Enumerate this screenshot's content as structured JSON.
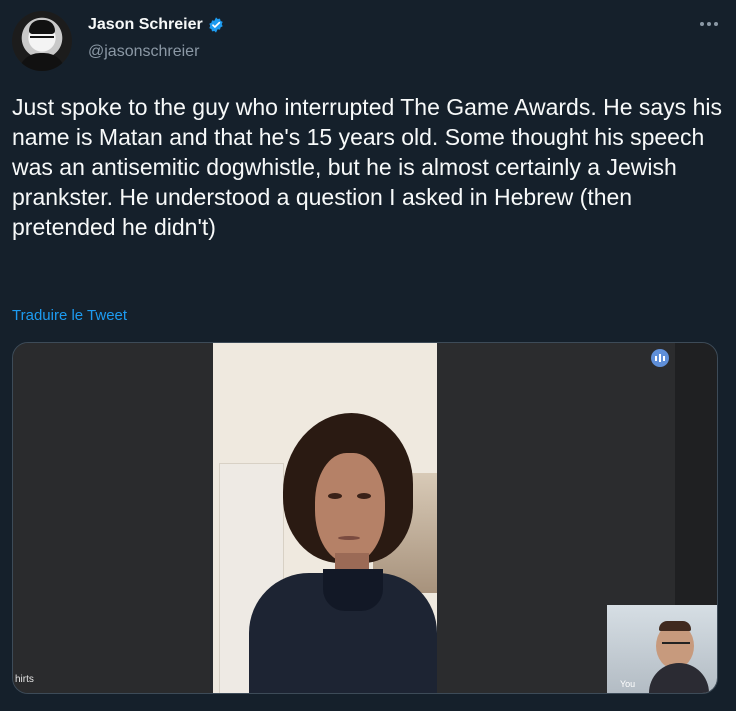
{
  "author": {
    "name": "Jason Schreier",
    "handle": "@jasonschreier",
    "verified_color": "#1d9bf0"
  },
  "tweet": {
    "text": "Just spoke to the guy who interrupted The Game Awards. He says his name is Matan and that he's 15 years old. Some thought his speech was an antisemitic dogwhistle, but he is almost certainly a Jewish prankster. He understood a question I asked in Hebrew (then pretended he didn't)",
    "translate_label": "Traduire le Tweet"
  },
  "media": {
    "left_label": "hirts",
    "self_label": "You",
    "audio_icon": "audio-indicator-icon"
  },
  "colors": {
    "background": "#15202b",
    "text": "#f7f9f9",
    "muted": "#8b98a5",
    "link": "#1d9bf0"
  }
}
